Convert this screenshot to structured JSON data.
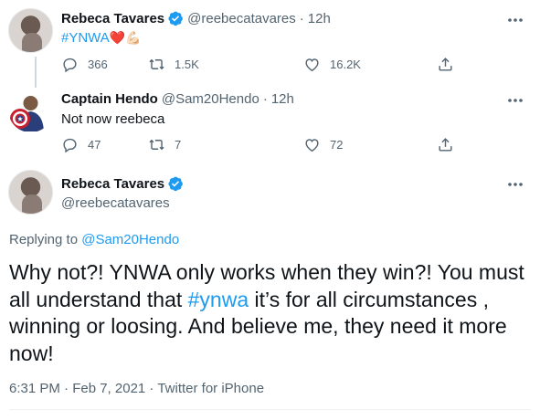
{
  "tweet1": {
    "name": "Rebeca Tavares",
    "handle": "@reebecatavares",
    "sep": "·",
    "time": "12h",
    "text_hashtag": "#YNWA",
    "text_emoji": "❤️💪🏻",
    "stats": {
      "replies": "366",
      "retweets": "1.5K",
      "likes": "16.2K"
    }
  },
  "tweet2": {
    "name": "Captain Hendo",
    "handle": "@Sam20Hendo",
    "sep": "·",
    "time": "12h",
    "text": "Not now reebeca",
    "stats": {
      "replies": "47",
      "retweets": "7",
      "likes": "72"
    }
  },
  "tweet3": {
    "name": "Rebeca Tavares",
    "handle": "@reebecatavares",
    "replying_prefix": "Replying to ",
    "replying_to": "@Sam20Hendo",
    "text_part1": "Why not?! YNWA only works when they win?! You must all understand that ",
    "text_hashtag": "#ynwa",
    "text_part2": " it’s for all circumstances , winning or loosing.  And believe me, they need it more now!",
    "timestamp": "6:31 PM · Feb 7, 2021 · ",
    "source": "Twitter for iPhone"
  },
  "colors": {
    "accent": "#1d9bf0",
    "secondary_text": "#536471",
    "heart_red": "#e0245e"
  }
}
